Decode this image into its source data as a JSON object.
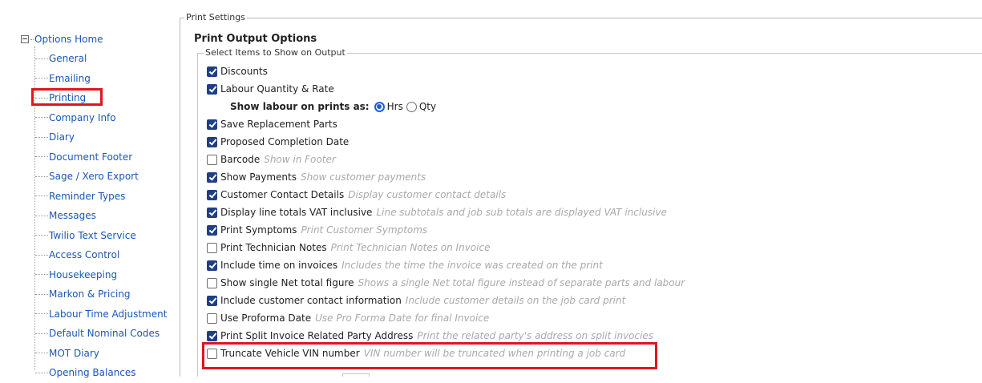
{
  "nav": {
    "root_label": "Options Home",
    "items": [
      {
        "label": "General"
      },
      {
        "label": "Emailing"
      },
      {
        "label": "Printing"
      },
      {
        "label": "Company Info"
      },
      {
        "label": "Diary"
      },
      {
        "label": "Document Footer"
      },
      {
        "label": "Sage / Xero Export"
      },
      {
        "label": "Reminder Types"
      },
      {
        "label": "Messages"
      },
      {
        "label": "Twilio Text Service"
      },
      {
        "label": "Access Control"
      },
      {
        "label": "Housekeeping"
      },
      {
        "label": "Markon & Pricing"
      },
      {
        "label": "Labour Time Adjustment"
      },
      {
        "label": "Default Nominal Codes"
      },
      {
        "label": "MOT Diary"
      },
      {
        "label": "Opening Balances"
      }
    ],
    "highlighted_item": "Printing"
  },
  "print_settings": {
    "legend": "Print Settings",
    "title": "Print Output Options",
    "group_legend": "Select Items to Show on Output",
    "options": [
      {
        "label": "Discounts",
        "help": "",
        "checked": true
      },
      {
        "label": "Labour Quantity & Rate",
        "help": "",
        "checked": true
      },
      {
        "label": "Save Replacement Parts",
        "help": "",
        "checked": true
      },
      {
        "label": "Proposed Completion Date",
        "help": "",
        "checked": true
      },
      {
        "label": "Barcode",
        "help": "Show in Footer",
        "checked": false
      },
      {
        "label": "Show Payments",
        "help": "Show customer payments",
        "checked": true
      },
      {
        "label": "Customer Contact Details",
        "help": "Display customer contact details",
        "checked": true
      },
      {
        "label": "Display line totals VAT inclusive",
        "help": "Line subtotals and job sub totals are displayed VAT inclusive",
        "checked": true
      },
      {
        "label": "Print Symptoms",
        "help": "Print Customer Symptoms",
        "checked": true
      },
      {
        "label": "Print Technician Notes",
        "help": "Print Technician Notes on Invoice",
        "checked": false
      },
      {
        "label": "Include time on invoices",
        "help": "Includes the time the invoice was created on the print",
        "checked": true
      },
      {
        "label": "Show single Net total figure",
        "help": "Shows a single Net total figure instead of separate parts and labour",
        "checked": false
      },
      {
        "label": "Include customer contact information",
        "help": "Include customer details on the job card print",
        "checked": true
      },
      {
        "label": "Use Proforma Date",
        "help": "Use Pro Forma Date for final Invoice",
        "checked": false
      },
      {
        "label": "Print Split Invoice Related Party Address",
        "help": "Print the related party's address on split invocies",
        "checked": true
      },
      {
        "label": "Truncate Vehicle VIN number",
        "help": "VIN number will be truncated when printing a job card",
        "checked": false
      }
    ],
    "labour_display": {
      "label": "Show labour on prints as:",
      "choices": [
        {
          "label": "Hrs",
          "selected": true
        },
        {
          "label": "Qty",
          "selected": false
        }
      ]
    }
  },
  "colors": {
    "link": "#1a56b8",
    "checkbox_checked": "#1e3f86",
    "radio_selected": "#1a5fd6",
    "highlight_border": "#e0151d",
    "help_text": "#a9a9a9"
  }
}
